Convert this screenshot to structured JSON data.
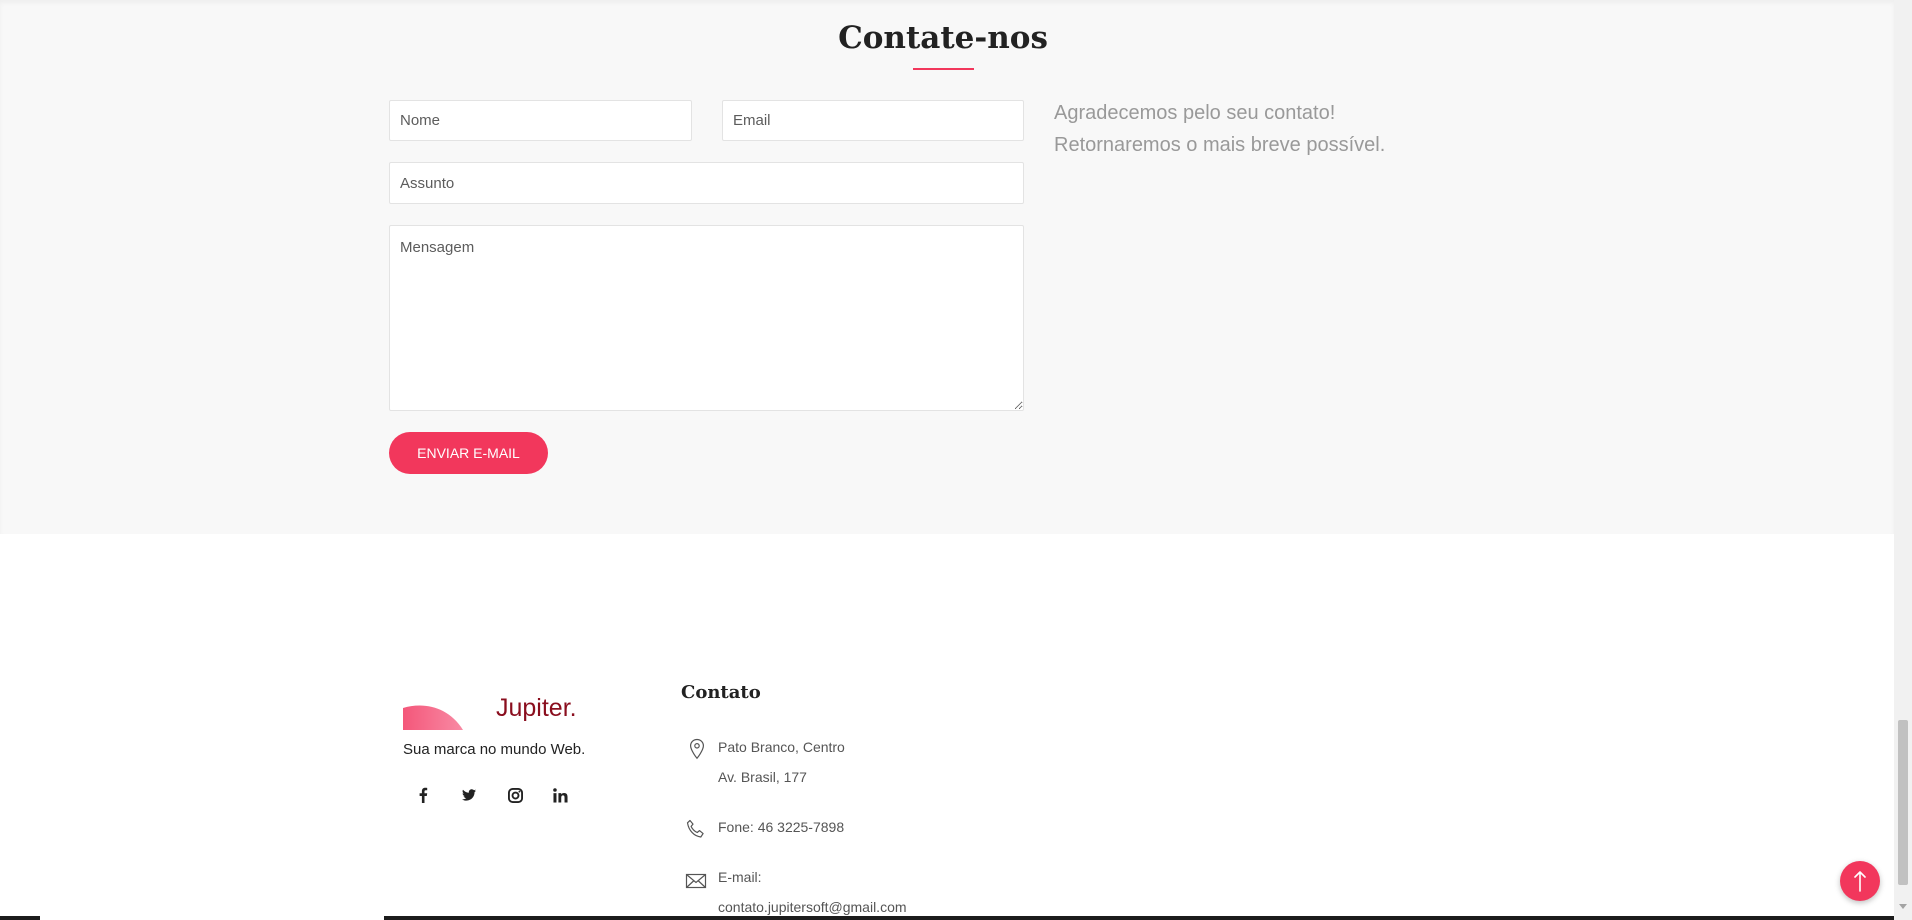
{
  "contact": {
    "title": "Contate-nos",
    "form": {
      "name_placeholder": "Nome",
      "email_placeholder": "Email",
      "subject_placeholder": "Assunto",
      "message_placeholder": "Mensagem",
      "submit_label": "ENVIAR E-MAIL"
    },
    "thanks_line1": "Agradecemos pelo seu contato!",
    "thanks_line2": "Retornaremos o mais breve possível."
  },
  "footer": {
    "brand": {
      "name": "Jupiter.",
      "tagline": "Sua marca no mundo Web."
    },
    "social": [
      {
        "icon": "facebook-icon"
      },
      {
        "icon": "twitter-icon"
      },
      {
        "icon": "instagram-icon"
      },
      {
        "icon": "linkedin-icon"
      }
    ],
    "contact": {
      "heading": "Contato",
      "address_line1": "Pato Branco, Centro",
      "address_line2": "Av. Brasil, 177",
      "phone": "Fone: 46 3225-7898",
      "email_label": "E-mail:",
      "email_value": "contato.jupitersoft@gmail.com"
    }
  },
  "colors": {
    "accent": "#f2375c",
    "brand_text": "#8a0e1e",
    "section_bg": "#f8f8f8",
    "muted_text": "#999999"
  },
  "scrollbar": {
    "position_fraction": 0.98
  }
}
